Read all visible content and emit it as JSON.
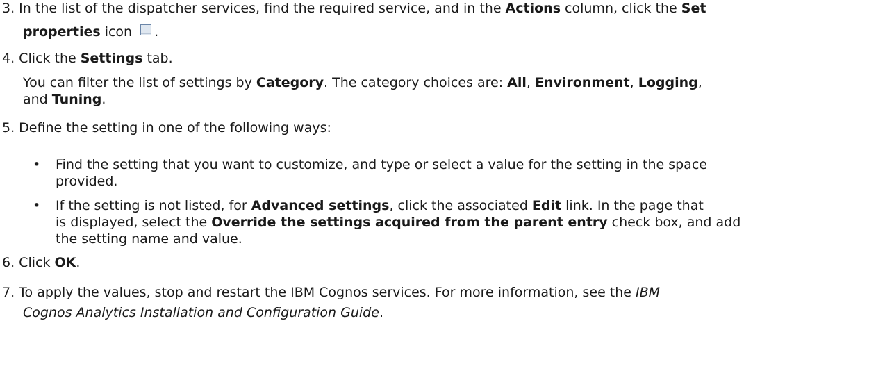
{
  "steps": {
    "s3": {
      "num": "3.",
      "t1": " In the list of the dispatcher services, find the required service, and in the ",
      "b1": "Actions",
      "t2": " column, click the ",
      "b2": "Set",
      "b3": "properties",
      "t3": " icon ",
      "t4": ".",
      "icon": "set-properties-icon"
    },
    "s4": {
      "num": "4.",
      "t1": " Click the ",
      "b1": "Settings",
      "t2": " tab.",
      "sub": {
        "t1": "You can filter the list of settings by ",
        "b1": "Category",
        "t2": ". The category choices are: ",
        "b2": "All",
        "t3": ", ",
        "b3": "Environment",
        "t4": ", ",
        "b4": "Logging",
        "t5": ",",
        "t6": "and ",
        "b5": "Tuning",
        "t7": "."
      }
    },
    "s5": {
      "num": "5.",
      "t1": " Define the setting in one of the following ways:",
      "bullets": [
        {
          "line1": "Find the setting that you want to customize, and type or select a value for the setting in the space",
          "line2": "provided."
        },
        {
          "t1": "If the setting is not listed, for ",
          "b1": "Advanced settings",
          "t2": ", click the associated ",
          "b2": "Edit",
          "t3": " link. In the page that",
          "t4": "is displayed, select the ",
          "b3": "Override the settings acquired from the parent entry",
          "t5": " check box, and add",
          "t6": "the setting name and value."
        }
      ]
    },
    "s6": {
      "num": "6.",
      "t1": " Click ",
      "b1": "OK",
      "t2": "."
    },
    "s7": {
      "num": "7.",
      "t1": " To apply the values, stop and restart the IBM Cognos services. For more information, see the ",
      "i1": "IBM",
      "i2": "Cognos Analytics Installation and Configuration Guide",
      "t2": "."
    }
  },
  "bullet_char": "•"
}
